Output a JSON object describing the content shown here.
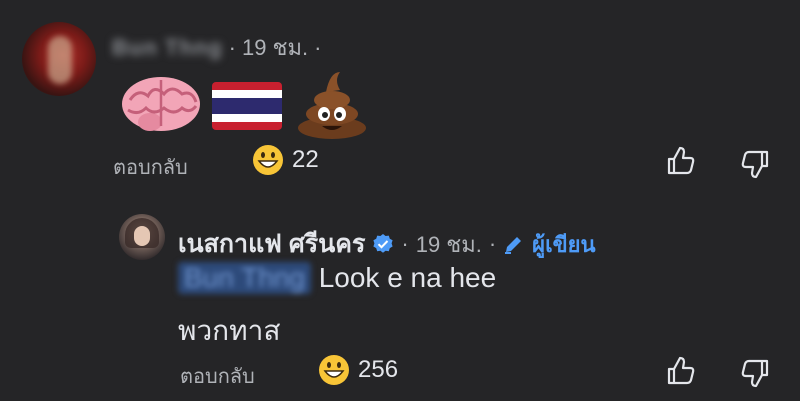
{
  "comment": {
    "author_blurred": "Bun Thng",
    "time": "19 ชม.",
    "dot": "·",
    "emojis": [
      "brain-emoji",
      "thailand-flag-emoji",
      "pile-of-poo-emoji"
    ],
    "reply_label": "ตอบกลับ",
    "reaction_emoji": "grinning-face",
    "reaction_count": "22"
  },
  "reply": {
    "author": "เนสกาแฟ ศรีนคร",
    "time": "19 ชม.",
    "author_label": "ผู้เขียน",
    "mention_blurred": "Bun Thng",
    "text_line1": "Look e na hee",
    "text_line2": "พวกทาส",
    "reply_label": "ตอบกลับ",
    "reaction_emoji": "grinning-face",
    "reaction_count": "256"
  },
  "colors": {
    "background": "#252527",
    "text_primary": "#e4e6eb",
    "text_secondary": "#b0b3b8",
    "verified_blue": "#4e9bf7"
  }
}
